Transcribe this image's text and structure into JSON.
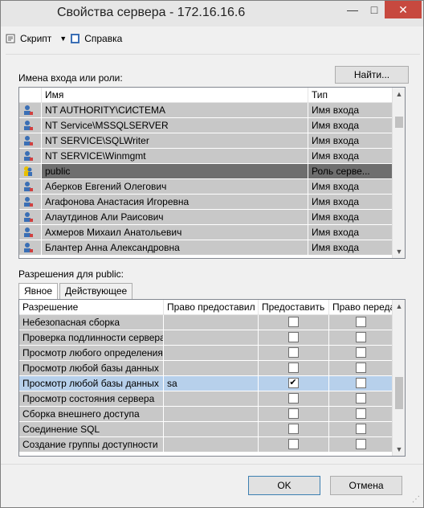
{
  "window": {
    "title": "Свойства сервера - 172.16.16.6",
    "controls": {
      "minimize": "—",
      "maximize": "□",
      "close": "✕"
    }
  },
  "toolbar": {
    "script_label": "Скрипт",
    "dropdown_icon": "▼",
    "help_label": "Справка"
  },
  "logins": {
    "section_label": "Имена входа или роли:",
    "find_button": "Найти...",
    "columns": [
      "Имя",
      "Тип"
    ],
    "rows": [
      {
        "name": "NT AUTHORITY\\СИСТЕМА",
        "type": "Имя входа"
      },
      {
        "name": "NT Service\\MSSQLSERVER",
        "type": "Имя входа"
      },
      {
        "name": "NT SERVICE\\SQLWriter",
        "type": "Имя входа"
      },
      {
        "name": "NT SERVICE\\Winmgmt",
        "type": "Имя входа"
      },
      {
        "name": "public",
        "type": "Роль серве...",
        "selected": true
      },
      {
        "name": "Аберков Евгений Олегович",
        "type": "Имя входа"
      },
      {
        "name": "Агафонова Анастасия Игоревна",
        "type": "Имя входа"
      },
      {
        "name": "Алаутдинов Али Раисович",
        "type": "Имя входа"
      },
      {
        "name": "Ахмеров Михаил Анатольевич",
        "type": "Имя входа"
      },
      {
        "name": "Блантер Анна Александровна",
        "type": "Имя входа"
      }
    ]
  },
  "permissions": {
    "section_label": "Разрешения для public:",
    "tabs": [
      "Явное",
      "Действующее"
    ],
    "columns": [
      "Разрешение",
      "Право предоставил",
      "Предоставить",
      "Право переда"
    ],
    "rows": [
      {
        "permission": "Небезопасная сборка",
        "grantor": "",
        "grant": false,
        "with_grant": false
      },
      {
        "permission": "Проверка подлинности сервера",
        "grantor": "",
        "grant": false,
        "with_grant": false
      },
      {
        "permission": "Просмотр любого определения",
        "grantor": "",
        "grant": false,
        "with_grant": false
      },
      {
        "permission": "Просмотр любой базы данных",
        "grantor": "",
        "grant": false,
        "with_grant": false
      },
      {
        "permission": "Просмотр любой базы данных",
        "grantor": "sa",
        "grant": true,
        "with_grant": false,
        "selected": true
      },
      {
        "permission": "Просмотр состояния сервера",
        "grantor": "",
        "grant": false,
        "with_grant": false
      },
      {
        "permission": "Сборка внешнего доступа",
        "grantor": "",
        "grant": false,
        "with_grant": false
      },
      {
        "permission": "Соединение SQL",
        "grantor": "",
        "grant": false,
        "with_grant": false
      },
      {
        "permission": "Создание группы доступности",
        "grantor": "",
        "grant": false,
        "with_grant": false
      }
    ]
  },
  "footer": {
    "ok_label": "OK",
    "cancel_label": "Отмена"
  },
  "colors": {
    "row_bg": "#c8c8c8",
    "selected_row_bg": "#7b7b7b",
    "selected_perm_bg": "#b7d0eb",
    "close_button": "#c7493f"
  }
}
